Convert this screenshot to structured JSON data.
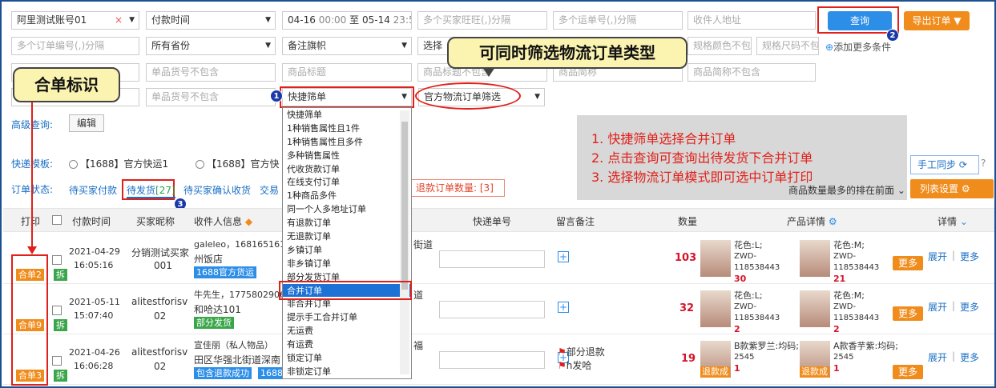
{
  "filters": {
    "account": "阿里测试账号01",
    "account_clear": "×",
    "time_type": "付款时间",
    "date_from": "04-16",
    "time_from": "00:00",
    "date_sep": "至",
    "date_to": "05-14",
    "time_to": "23:59",
    "buyer_ph": "多个买家旺旺(,)分隔",
    "waybill_ph": "多个运单号(,)分隔",
    "address_ph": "收件人地址",
    "query_btn": "查询",
    "export_btn": "导出订单",
    "order_no_ph": "多个订单编号(,)分隔",
    "province": "所有省份",
    "remark_flag": "备注旗帜",
    "choose": "选择",
    "spec_color_ph": "规格颜色不包",
    "spec_size_ph": "规格尺码不包",
    "add_more": "添加更多条件",
    "goods_no_ph": "单品货号不包含",
    "goods_title_ph": "商品标题",
    "goods_title_ex_ph": "商品标题不包含",
    "goods_short_ph": "商品简称",
    "goods_short_ex_ph": "商品简称不包含",
    "goods_no_ph2": "单品货号不包含",
    "quick_filter": "快捷筛单",
    "logistics_filter": "官方物流订单筛选",
    "advanced_label": "高级查询:",
    "edit_btn": "编辑"
  },
  "callouts": {
    "multi_filter": "可同时筛选物流订单类型",
    "merge_mark": "合单标识"
  },
  "badges": {
    "b1": "1",
    "b2": "2",
    "b3": "3"
  },
  "instructions": [
    "1. 快捷筛单选择合并订单",
    "2. 点击查询可查询出待发货下合并订单",
    "3. 选择物流订单模式即可选中订单打印"
  ],
  "express": {
    "label": "快递模板:",
    "opt1": "【1688】官方快运1",
    "opt2": "【1688】官方快"
  },
  "status": {
    "label": "订单状态:",
    "wait_pay": "待买家付款",
    "wait_ship": "待发货",
    "wait_ship_count": "[27]",
    "wait_confirm": "待买家确认收货",
    "trade": "交易",
    "refund_label": "退款订单数量:",
    "refund_count": "[3]",
    "sort_hint": "商品数量最多的排在前面"
  },
  "tools": {
    "manual_sync": "手工同步",
    "col_settings": "列表设置"
  },
  "dropdown": [
    "快捷筛单",
    "1种销售属性且1件",
    "1种销售属性且多件",
    "多种销售属性",
    "代收货款订单",
    "在线支付订单",
    "1种商品多件",
    "同一个人多地址订单",
    "有退款订单",
    "无退款订单",
    "乡镇订单",
    "非乡镇订单",
    "部分发货订单",
    "合并订单",
    "非合并订单",
    "提示手工合并订单",
    "无运费",
    "有运费",
    "锁定订单",
    "非锁定订单"
  ],
  "table_headers": {
    "print": "打印",
    "pay_time": "付款时间",
    "buyer": "买家昵称",
    "receiver": "收件人信息",
    "express_no": "快递单号",
    "remark": "留言备注",
    "qty": "数量",
    "product": "产品详情",
    "detail": "详情"
  },
  "rows": [
    {
      "merge": "合单2",
      "split": "拆",
      "date": "2021-04-29",
      "time": "16:05:16",
      "buyer1": "分销测试买家",
      "buyer2": "001",
      "recv1": "galeleo，1681651618",
      "recv2": "州饭店",
      "recv_tag": "1688官方货运",
      "addr_tail": "街道",
      "qty": "103",
      "p1_color": "花色:L;",
      "p1_code": "ZWD-118538443",
      "p1_qty": "30",
      "p2_color": "花色:M;",
      "p2_code": "ZWD-118538443",
      "p2_qty": "21",
      "more": "更多",
      "expand": "展开",
      "more_link": "更多",
      "remark_lines": []
    },
    {
      "merge": "合单9",
      "split": "拆",
      "date": "2021-05-11",
      "time": "15:07:40",
      "buyer1": "alitestforisv",
      "buyer2": "02",
      "recv1": "牛先生，1775802906",
      "recv2": "和哈达101",
      "recv_tag": "部分发货",
      "addr_tail": "道",
      "qty": "32",
      "p1_color": "花色:L;",
      "p1_code": "ZWD-118538443",
      "p1_qty": "2",
      "p2_color": "花色:M;",
      "p2_code": "ZWD-118538443",
      "p2_qty": "2",
      "more": "更多",
      "expand": "展开",
      "more_link": "更多",
      "remark_lines": []
    },
    {
      "merge": "合单3",
      "split": "拆",
      "date": "2021-04-26",
      "time": "16:06:28",
      "buyer1": "alitestforisv",
      "buyer2": "02",
      "recv1": "宣佳丽（私人物品）",
      "recv2": "田区华强北街道深南",
      "recv_tag": "包含退款成功",
      "recv_tag2": "1688官",
      "addr_tail": "福",
      "qty": "19",
      "p1_color": "B款紫罗兰:均码;",
      "p1_code": "2545",
      "p1_qty": "1",
      "p1_tag": "退款成",
      "p2_color": "A款香芋紫:均码;",
      "p2_code": "2545",
      "p2_qty": "1",
      "p2_tag": "退款成",
      "more": "更多",
      "expand": "展开",
      "more_link": "更多",
      "remark_lines": [
        "部分退款",
        "h发哈"
      ]
    }
  ],
  "colors": {
    "accent": "#2d8ee8",
    "orange": "#f08c1c",
    "red": "#e0201a",
    "qty_red": "#d4142a"
  }
}
